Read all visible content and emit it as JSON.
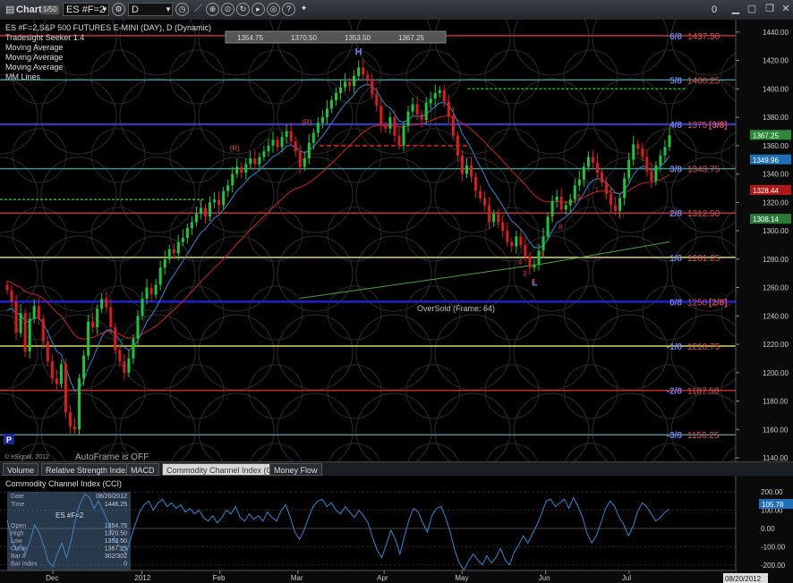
{
  "window": {
    "title": "Chart",
    "symbol": "ES #F=2",
    "interval": "D",
    "right_tag": "0"
  },
  "main": {
    "header_line": "ES #F=2,S&P 500 FUTURES E-MINI (DAY), D (Dynamic)",
    "studies": [
      "Tradesight Seeker 1.4",
      "Moving Average",
      "Moving Average",
      "Moving Average",
      "MM Lines"
    ],
    "ohlc_box": [
      "1354.75",
      "1370.50",
      "1353.50",
      "1367.25"
    ],
    "oversold_label": "OverSold (Frame: 64)",
    "h_label": "H",
    "l_label": "L",
    "r_label": "(R)",
    "seeker_nums": [
      {
        "t": "3",
        "date": "2012-05-24"
      },
      {
        "t": "4",
        "date": "2012-05-22"
      },
      {
        "t": "5",
        "date": "2012-05-28"
      },
      {
        "t": "6",
        "date": "2012-05-31"
      },
      {
        "t": "7",
        "date": "2012-06-04"
      },
      {
        "t": "8",
        "date": "2012-06-06"
      },
      {
        "t": "9",
        "date": "2012-06-14"
      },
      {
        "t": "1",
        "date": "2012-06-21"
      },
      {
        "t": "17",
        "date": "2012-06-28"
      }
    ],
    "autoframe": "AutoFrame is OFF",
    "esignal": "© eSignal, 2012",
    "p_badge": "P"
  },
  "tabs": [
    "Volume",
    "Relative Strength Index",
    "MACD",
    "Commodity Channel Index (CCI)",
    "Money Flow"
  ],
  "active_tab": 3,
  "cci": {
    "title": "Commodity Channel Index (CCI)",
    "current": "105.78",
    "date_label": "08/20/2012",
    "cursor_panel": {
      "symbol": "ES #F=2",
      "rows": [
        [
          "Date",
          "08/20/2012"
        ],
        [
          "Time",
          "1446.25"
        ],
        [
          "Open",
          "1354.75"
        ],
        [
          "High",
          "1370.50"
        ],
        [
          "Low",
          "1353.50"
        ],
        [
          "Close",
          "1367.25"
        ],
        [
          "Bar #",
          "302/302"
        ],
        [
          "Bar index",
          "0"
        ]
      ],
      "foot": "Tradesight Seeker 1.4"
    }
  },
  "chart_data": {
    "type": "candlestick",
    "x_start": "2011-11-14",
    "x_end": "2012-07-17",
    "ylim": [
      1140,
      1450
    ],
    "yticks": [
      1140,
      1160,
      1180,
      1200,
      1220,
      1240,
      1260,
      1280,
      1300,
      1320,
      1340,
      1360,
      1380,
      1400,
      1420,
      1440
    ],
    "x_tick_labels": [
      {
        "label": "Dec",
        "date": "2011-12-01"
      },
      {
        "label": "2012",
        "date": "2012-01-03"
      },
      {
        "label": "Feb",
        "date": "2012-02-01"
      },
      {
        "label": "Mar",
        "date": "2012-03-01"
      },
      {
        "label": "Apr",
        "date": "2012-04-02"
      },
      {
        "label": "May",
        "date": "2012-05-01"
      },
      {
        "label": "Jun",
        "date": "2012-06-01"
      },
      {
        "label": "Jul",
        "date": "2012-07-02"
      }
    ],
    "mm_lines": [
      {
        "label": "6/8",
        "value": 1437.5,
        "text": "1437.50",
        "color": "#c03030"
      },
      {
        "label": "5/8",
        "value": 1406.25,
        "text": "1406.25",
        "color": "#4a8a8a"
      },
      {
        "label": "4/8",
        "value": 1375,
        "text": "1375",
        "color": "#3a3aaa",
        "tag": "[3/8]"
      },
      {
        "label": "3/8",
        "value": 1343.75,
        "text": "1343.75",
        "color": "#4a8a8a"
      },
      {
        "label": "2/8",
        "value": 1312.5,
        "text": "1312.50",
        "color": "#c03030"
      },
      {
        "label": "1/8",
        "value": 1281.25,
        "text": "1281.25",
        "color": "#d8d860"
      },
      {
        "label": "0/8",
        "value": 1250,
        "text": "1250",
        "color": "#2020d0",
        "tag": "[2/8]"
      },
      {
        "label": "-1/8",
        "value": 1218.75,
        "text": "1218.75",
        "color": "#d8d860"
      },
      {
        "label": "-2/8",
        "value": 1187.5,
        "text": "1187.50",
        "color": "#c03030"
      },
      {
        "label": "-3/8",
        "value": 1156.25,
        "text": "1156.25",
        "color": "#4a8a8a"
      }
    ],
    "price_tags": [
      {
        "value": 1367.25,
        "text": "1367.25",
        "color": "#2a8a3a"
      },
      {
        "value": 1349.96,
        "text": "1349.96",
        "color": "#1f6fb8"
      },
      {
        "value": 1328.44,
        "text": "1328.44",
        "color": "#b01818"
      },
      {
        "value": 1308.14,
        "text": "1308.14",
        "color": "#2a7a3a"
      }
    ],
    "closes": [
      1258,
      1250,
      1228,
      1242,
      1215,
      1238,
      1247,
      1238,
      1222,
      1208,
      1196,
      1192,
      1206,
      1172,
      1162,
      1160,
      1196,
      1212,
      1236,
      1232,
      1245,
      1252,
      1246,
      1232,
      1216,
      1208,
      1200,
      1210,
      1224,
      1240,
      1252,
      1260,
      1255,
      1262,
      1274,
      1280,
      1287,
      1284,
      1292,
      1295,
      1302,
      1306,
      1312,
      1316,
      1310,
      1320,
      1322,
      1318,
      1328,
      1332,
      1340,
      1345,
      1341,
      1347,
      1351,
      1347,
      1352,
      1356,
      1360,
      1364,
      1359,
      1366,
      1370,
      1363,
      1356,
      1345,
      1351,
      1362,
      1369,
      1376,
      1380,
      1386,
      1392,
      1397,
      1401,
      1405,
      1402,
      1409,
      1415,
      1410,
      1407,
      1396,
      1388,
      1374,
      1372,
      1380,
      1367,
      1360,
      1374,
      1384,
      1389,
      1382,
      1378,
      1390,
      1393,
      1397,
      1399,
      1391,
      1381,
      1367,
      1353,
      1340,
      1346,
      1338,
      1328,
      1323,
      1318,
      1306,
      1312,
      1306,
      1300,
      1292,
      1289,
      1296,
      1290,
      1282,
      1274,
      1276,
      1286,
      1296,
      1310,
      1321,
      1324,
      1315,
      1318,
      1322,
      1332,
      1336,
      1345,
      1352,
      1348,
      1341,
      1334,
      1326,
      1318,
      1314,
      1323,
      1337,
      1350,
      1361,
      1358,
      1352,
      1342,
      1335,
      1346,
      1353,
      1359,
      1367.25
    ],
    "ma_red_start": 1265,
    "ma_blue_start": 1240,
    "cci": [
      45,
      -60,
      -120,
      -90,
      -140,
      -70,
      20,
      -20,
      -95,
      -180,
      -210,
      -140,
      -80,
      -160,
      -70,
      60,
      140,
      190,
      170,
      110,
      150,
      95,
      40,
      -30,
      -80,
      -110,
      -140,
      -60,
      20,
      90,
      130,
      150,
      100,
      140,
      160,
      120,
      140,
      110,
      130,
      90,
      110,
      80,
      100,
      60,
      40,
      70,
      30,
      60,
      100,
      80,
      120,
      60,
      40,
      80,
      50,
      70,
      40,
      90,
      60,
      40,
      100,
      130,
      60,
      -20,
      -60,
      -10,
      60,
      120,
      150,
      160,
      120,
      140,
      100,
      80,
      120,
      90,
      60,
      100,
      70,
      30,
      -50,
      -120,
      -160,
      -90,
      -10,
      -60,
      -140,
      -40,
      50,
      110,
      90,
      30,
      -20,
      70,
      110,
      120,
      60,
      -20,
      -120,
      -190,
      -230,
      -180,
      -140,
      -170,
      -200,
      -150,
      -190,
      -160,
      -110,
      -170,
      -200,
      -130,
      -90,
      -40,
      -80,
      -30,
      20,
      80,
      150,
      160,
      120,
      140,
      160,
      110,
      170,
      120,
      60,
      -30,
      -80,
      -40,
      30,
      110,
      150,
      120,
      60,
      20,
      -40,
      10,
      90,
      140,
      120,
      80,
      40,
      60,
      90,
      105.78
    ],
    "cci_ylim": [
      -260,
      260
    ],
    "cci_ticks": [
      200,
      100,
      0,
      -100,
      -200
    ],
    "cci_tick_labels": [
      "200.00",
      "100.00",
      "0.00",
      "-100.00",
      "-200.00"
    ]
  }
}
